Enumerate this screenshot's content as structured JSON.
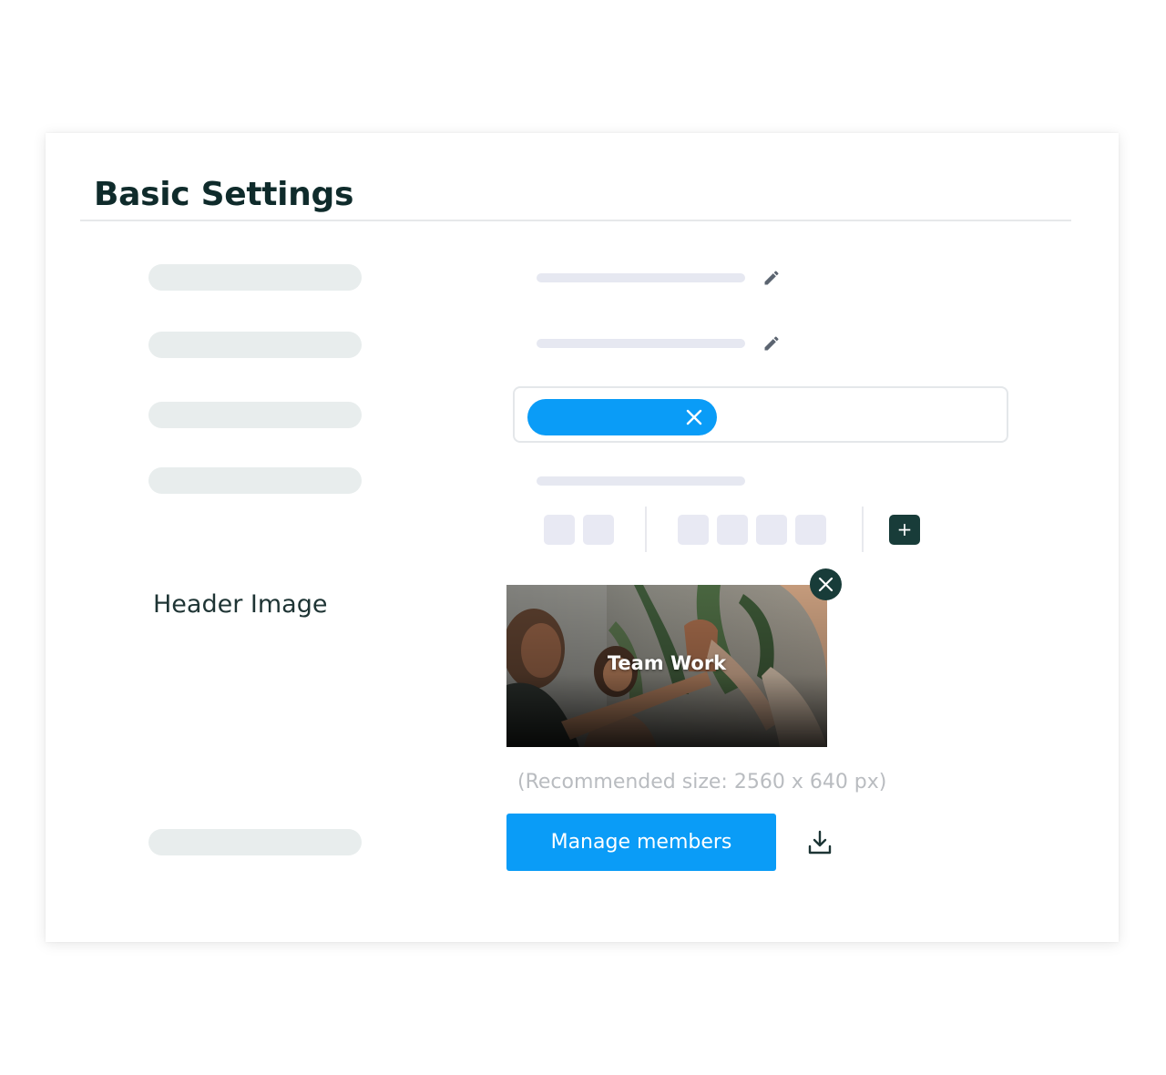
{
  "page": {
    "title": "Basic Settings"
  },
  "header_image": {
    "label": "Header Image",
    "caption": "Team Work",
    "hint": "(Recommended size: 2560 x 640 px)"
  },
  "actions": {
    "manage_members_label": "Manage members"
  },
  "icons": {
    "edit": "pencil-icon",
    "tag_remove": "close-icon",
    "add": "plus-icon",
    "image_remove": "close-icon",
    "download": "download-icon"
  },
  "add_symbol": "+",
  "colors": {
    "accent": "#0a9cf7",
    "dark": "#183c39",
    "title": "#0f2b2b",
    "placeholder": "#e8eded",
    "hint": "#b9bcc0"
  }
}
